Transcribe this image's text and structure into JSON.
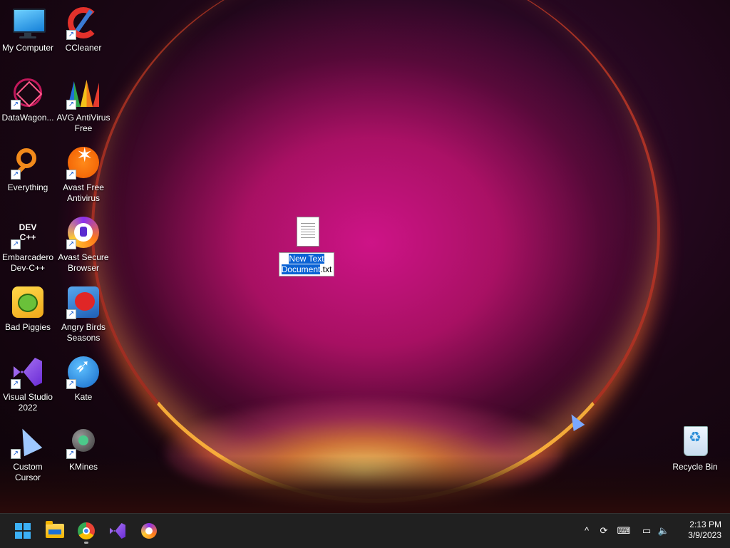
{
  "desktop": {
    "icons": [
      {
        "label": "My Computer"
      },
      {
        "label": "CCleaner"
      },
      {
        "label": "DataWagon..."
      },
      {
        "label": "AVG AntiVirus Free"
      },
      {
        "label": "Everything"
      },
      {
        "label": "Avast Free Antivirus"
      },
      {
        "label": "Embarcadero Dev-C++"
      },
      {
        "label": "Avast Secure Browser"
      },
      {
        "label": "Bad Piggies"
      },
      {
        "label": "Angry Birds Seasons"
      },
      {
        "label": "Visual Studio 2022"
      },
      {
        "label": "Kate"
      },
      {
        "label": "Custom Cursor"
      },
      {
        "label": "KMines"
      }
    ],
    "new_file": {
      "name_selected": "New Text Document",
      "name_rest": ".txt"
    },
    "recycle_bin": {
      "label": "Recycle Bin"
    },
    "devcpp_badge": "DEV C++",
    "shortcut_arrow": "↗"
  },
  "taskbar": {
    "pinned": [
      "start-icon",
      "file-explorer-icon",
      "chrome-icon",
      "visual-studio-icon",
      "avast-secure-browser-icon"
    ],
    "tray": {
      "chevron": "^",
      "sync": "⟳",
      "keyboard": "⌨",
      "network": "▭",
      "volume": "🔈"
    },
    "clock": {
      "time": "2:13 PM",
      "date": "3/9/2023"
    }
  },
  "colors": {
    "taskbar_bg": "#202020",
    "selection": "#0a62d4",
    "accent": "#3cb0f5"
  }
}
